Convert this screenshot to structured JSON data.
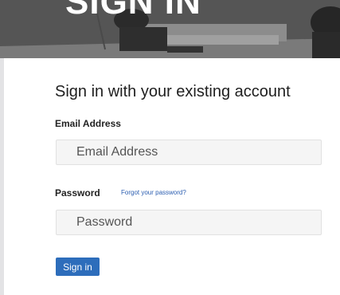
{
  "hero": {
    "title": "SIGN IN"
  },
  "form": {
    "heading": "Sign in with your existing account",
    "email_label": "Email Address",
    "email_placeholder": "Email Address",
    "email_value": "",
    "password_label": "Password",
    "forgot_link": "Forgot your password?",
    "password_placeholder": "Password",
    "password_value": "",
    "submit_label": "Sign in"
  },
  "colors": {
    "accent": "#2d6dbb",
    "link": "#2a5db0",
    "hero_dark": "#3b3b3b"
  },
  "icons": {
    "hero_image": "office-lounge-photo"
  }
}
